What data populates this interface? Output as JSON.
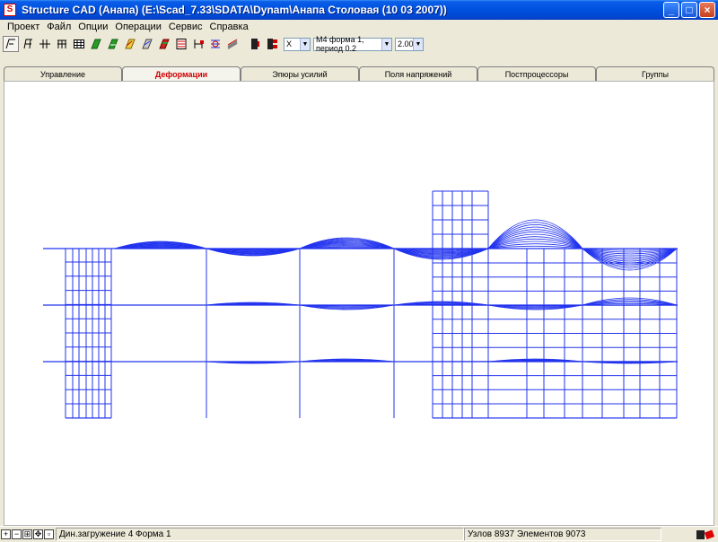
{
  "window": {
    "title": "Structure CAD (Анапа) (E:\\Scad_7.33\\SDATA\\Dynam\\Анапа Столовая (10 03 2007))",
    "controls": [
      "_",
      "□",
      "×"
    ]
  },
  "menu": [
    "Проект",
    "Файл",
    "Опции",
    "Операции",
    "Сервис",
    "Справка"
  ],
  "toolbar": {
    "buttons": [
      "select-icon",
      "frame-icon",
      "node-icon",
      "grid-icon",
      "table-icon",
      "shape-icon",
      "loads-icon",
      "deform-icon",
      "surface-icon",
      "section-icon",
      "settings-icon",
      "support-icon",
      "layer-icon",
      "print-icon",
      "color-icon",
      "filter-icon"
    ],
    "direction_select": "X",
    "form_select": "М4 форма 1, период 0.2",
    "scale_select": "2.00"
  },
  "tabs": [
    {
      "label": "Управление",
      "active": false
    },
    {
      "label": "Деформации",
      "active": true
    },
    {
      "label": "Эпюры усилий",
      "active": false
    },
    {
      "label": "Поля напряжений",
      "active": false
    },
    {
      "label": "Постпроцессоры",
      "active": false
    },
    {
      "label": "Группы",
      "active": false
    }
  ],
  "status": {
    "load_info": "Дин.загружение 4  Форма 1",
    "counts": "Узлов 8937 Элементов 9073"
  },
  "colors": {
    "model": "#2233ee",
    "active_tab": "#d00000"
  }
}
